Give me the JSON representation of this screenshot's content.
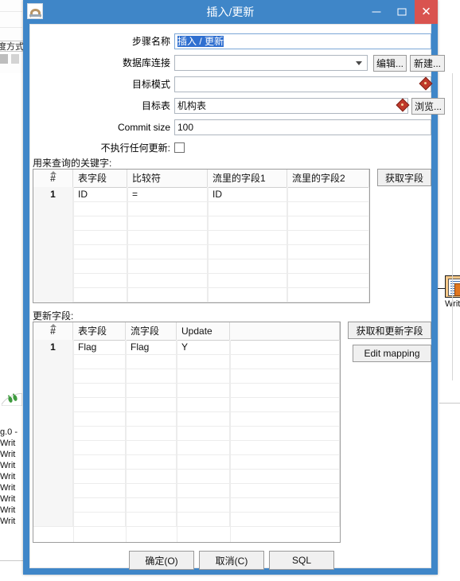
{
  "background": {
    "left_fragment_text": "度方式",
    "log_prefix": "g.0 -",
    "log_lines": [
      "Writ",
      "Writ",
      "Writ",
      "Writ",
      "Writ",
      "Writ",
      "Writ",
      "Writ"
    ],
    "canvas_step": {
      "icon": "write-to-table-icon",
      "label": "Write to"
    }
  },
  "dialog": {
    "title": "插入/更新",
    "icon_name": "pentaho-step-icon",
    "window_buttons": {
      "minimize": "minimize-icon",
      "maximize": "maximize-icon",
      "close": "✕"
    },
    "close_color": "#d9534f",
    "titlebar_color": "#3f86c8",
    "selection_color": "#2f6fd0",
    "form": {
      "step_name": {
        "label": "步骤名称",
        "value": "插入 / 更新",
        "selected": true
      },
      "db_connection": {
        "label": "数据库连接",
        "value": "",
        "edit_button": "编辑...",
        "new_button": "新建..."
      },
      "target_schema": {
        "label": "目标模式",
        "value": "",
        "variable_icon": "variable-diamond-icon"
      },
      "target_table": {
        "label": "目标表",
        "value": "机构表",
        "variable_icon": "variable-diamond-icon",
        "browse_button": "浏览..."
      },
      "commit_size": {
        "label": "Commit size",
        "value": "100"
      },
      "no_update": {
        "label": "不执行任何更新:",
        "checked": false
      }
    },
    "keys_section": {
      "label": "用来查询的关键字:",
      "columns": [
        "#",
        "表字段",
        "比较符",
        "流里的字段1",
        "流里的字段2"
      ],
      "rows": [
        [
          "1",
          "ID",
          "=",
          "ID",
          ""
        ]
      ],
      "empty_rows": 8,
      "get_fields_button": "获取字段"
    },
    "update_section": {
      "label": "更新字段:",
      "columns": [
        "#",
        "表字段",
        "流字段",
        "Update",
        ""
      ],
      "rows": [
        [
          "1",
          "Flag",
          "Flag",
          "Y",
          ""
        ]
      ],
      "empty_rows": 12,
      "get_update_fields_button": "获取和更新字段",
      "edit_mapping_button": "Edit mapping"
    },
    "footer": {
      "ok_button": "确定(O)",
      "cancel_button": "取消(C)",
      "sql_button": "SQL"
    }
  }
}
